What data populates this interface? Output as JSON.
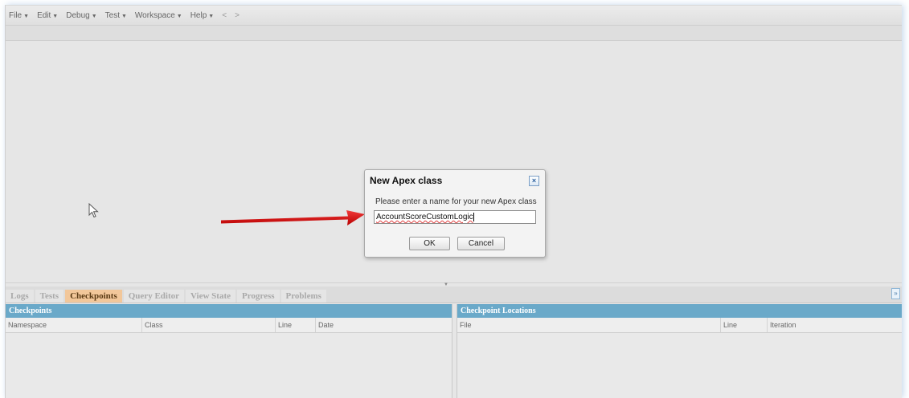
{
  "menu": {
    "items": [
      "File",
      "Edit",
      "Debug",
      "Test",
      "Workspace",
      "Help"
    ],
    "back": "<",
    "forward": ">"
  },
  "dialog": {
    "title": "New Apex class",
    "prompt": "Please enter a name for your new Apex class",
    "input_value": "AccountScoreCustomLogic",
    "ok_label": "OK",
    "cancel_label": "Cancel",
    "close_glyph": "×"
  },
  "tabs": [
    "Logs",
    "Tests",
    "Checkpoints",
    "Query Editor",
    "View State",
    "Progress",
    "Problems"
  ],
  "active_tab": "Checkpoints",
  "checkpoints": {
    "title": "Checkpoints",
    "columns": [
      "Namespace",
      "Class",
      "Line",
      "Date"
    ]
  },
  "locations": {
    "title": "Checkpoint Locations",
    "columns": [
      "File",
      "Line",
      "Iteration"
    ]
  },
  "colors": {
    "panel_header": "#6aa9c9",
    "active_tab": "#f2c79a",
    "annotation_arrow": "#e01010"
  },
  "icons": {
    "mouse_pointer": "mouse-pointer-icon",
    "annotation": "red-arrow-annotation",
    "close": "close-icon",
    "collapse": "collapse-icon"
  }
}
